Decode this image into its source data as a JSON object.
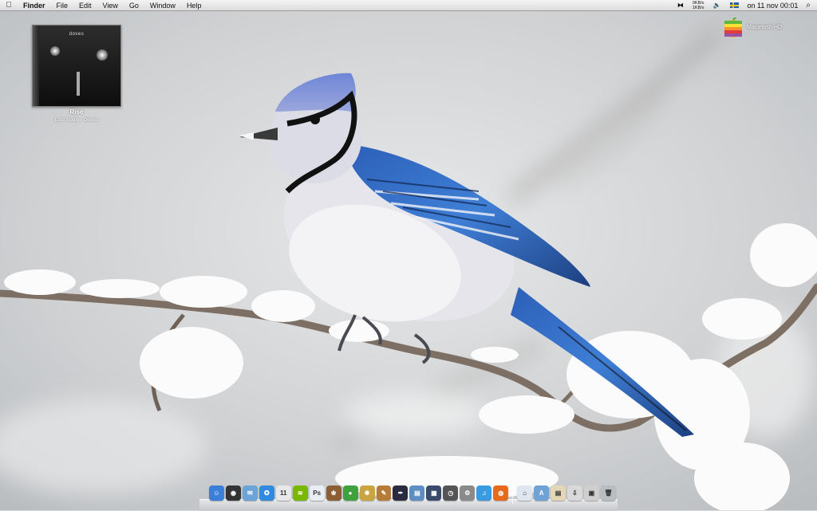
{
  "menubar": {
    "apple_icon": "apple-icon",
    "items": [
      "Finder",
      "File",
      "Edit",
      "View",
      "Go",
      "Window",
      "Help"
    ],
    "status": {
      "net_down": "0KB/s",
      "net_up": "1KB/s",
      "clock": "on 11 nov  00:01"
    }
  },
  "now_playing": {
    "album_cover_text": "doves",
    "track": "Rise",
    "artist_line": "Lost Souls - Doves"
  },
  "desktop": {
    "hd_label": "Macintosh HD"
  },
  "dock": {
    "apps": [
      {
        "name": "finder-icon",
        "color": "#3b7fd9",
        "glyph": "☺"
      },
      {
        "name": "dashboard-icon",
        "color": "#333333",
        "glyph": "◉"
      },
      {
        "name": "mail-icon",
        "color": "#6aa4d8",
        "glyph": "✉"
      },
      {
        "name": "safari-icon",
        "color": "#2f8ae0",
        "glyph": "✪"
      },
      {
        "name": "ical-icon",
        "color": "#e8e8e8",
        "glyph": "11"
      },
      {
        "name": "spotify-icon",
        "color": "#7ab800",
        "glyph": "≋"
      },
      {
        "name": "photoshop-icon",
        "color": "#e9eef5",
        "glyph": "Ps"
      },
      {
        "name": "iphoto-icon",
        "color": "#8b5e34",
        "glyph": "❀"
      },
      {
        "name": "adium-icon",
        "color": "#3fa23f",
        "glyph": "●"
      },
      {
        "name": "plant-icon",
        "color": "#c9a440",
        "glyph": "✹"
      },
      {
        "name": "notes-icon",
        "color": "#b87c3a",
        "glyph": "✎"
      },
      {
        "name": "quill-icon",
        "color": "#2a2a40",
        "glyph": "✒"
      },
      {
        "name": "preview-icon",
        "color": "#5d8fc4",
        "glyph": "▤"
      },
      {
        "name": "spaces-icon",
        "color": "#3a4a6a",
        "glyph": "▦"
      },
      {
        "name": "timemachine-icon",
        "color": "#555555",
        "glyph": "◷"
      },
      {
        "name": "system-preferences-icon",
        "color": "#8a8a8a",
        "glyph": "⚙"
      },
      {
        "name": "itunes-icon",
        "color": "#3b9be0",
        "glyph": "♫"
      },
      {
        "name": "firefox-icon",
        "color": "#e66a1a",
        "glyph": "◍"
      }
    ],
    "docs": [
      {
        "name": "home-folder-icon",
        "color": "#dfe6ef",
        "glyph": "⌂"
      },
      {
        "name": "applications-folder-icon",
        "color": "#6fa3d6",
        "glyph": "A"
      },
      {
        "name": "documents-stack-icon",
        "color": "#e4d7b8",
        "glyph": "▤"
      },
      {
        "name": "downloads-stack-icon",
        "color": "#d9d9d9",
        "glyph": "⇩"
      },
      {
        "name": "pictures-stack-icon",
        "color": "#cfcfcf",
        "glyph": "▣"
      },
      {
        "name": "trash-icon",
        "color": "#b9bcc0",
        "glyph": "🗑"
      }
    ]
  },
  "colors": {
    "sky": "#d7d9db",
    "jay_blue": "#4a78c8",
    "jay_breast": "#e4e3ea"
  }
}
